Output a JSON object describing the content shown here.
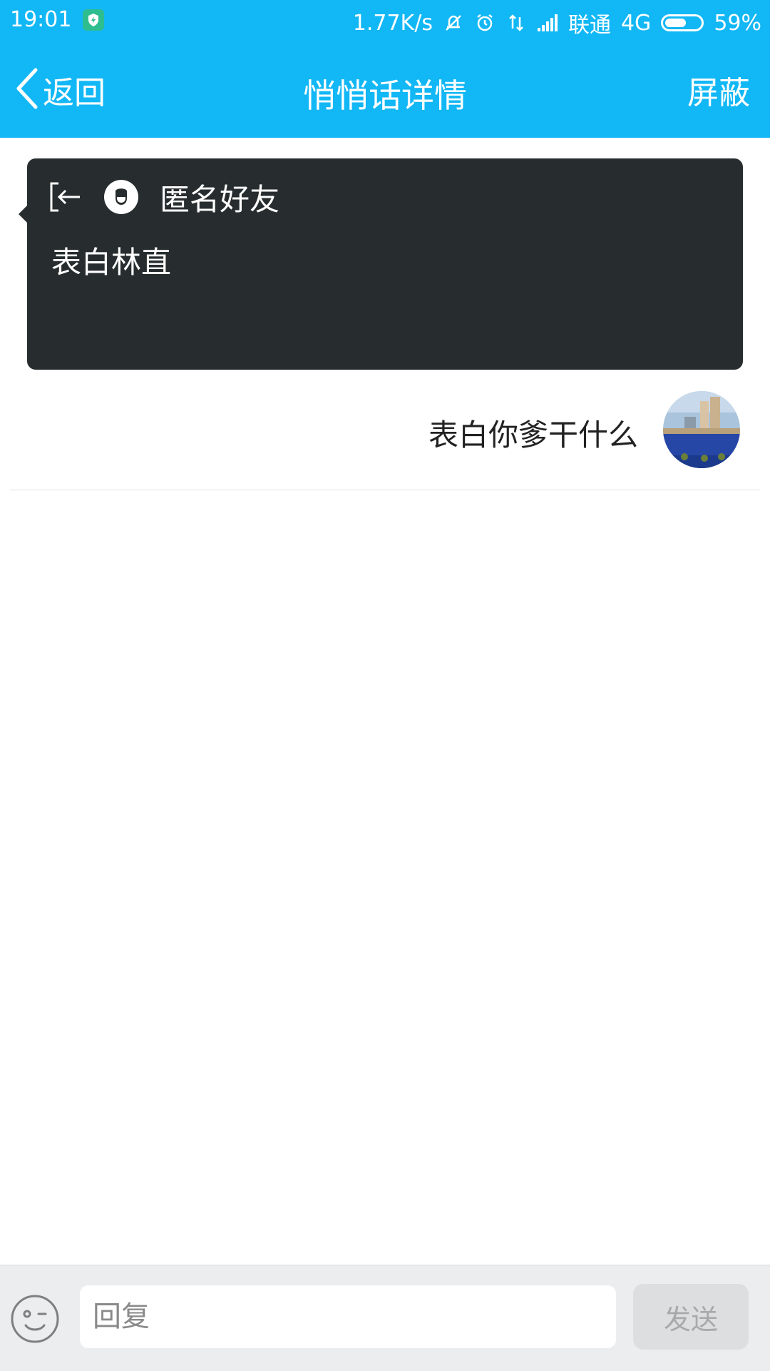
{
  "status_bar": {
    "time": "19:01",
    "net_speed": "1.77K/s",
    "carrier": "联通",
    "network": "4G",
    "battery": "59%",
    "battery_level": 0.59,
    "icons": [
      "shield-icon",
      "mute-bell-icon",
      "alarm-icon",
      "data-transfer-icon",
      "signal-icon",
      "battery-icon"
    ]
  },
  "nav": {
    "back_label": "返回",
    "title": "悄悄话详情",
    "action_label": "屏蔽"
  },
  "whisper": {
    "sender_name": "匿名好友",
    "message": "表白林直"
  },
  "reply": {
    "text": "表白你爹干什么"
  },
  "bottom_bar": {
    "input_placeholder": "回复",
    "send_label": "发送"
  },
  "colors": {
    "header": "#12b7f5",
    "card": "#272d2e",
    "bottom_bar": "#ebedef",
    "send_button": "#dcdee0"
  }
}
